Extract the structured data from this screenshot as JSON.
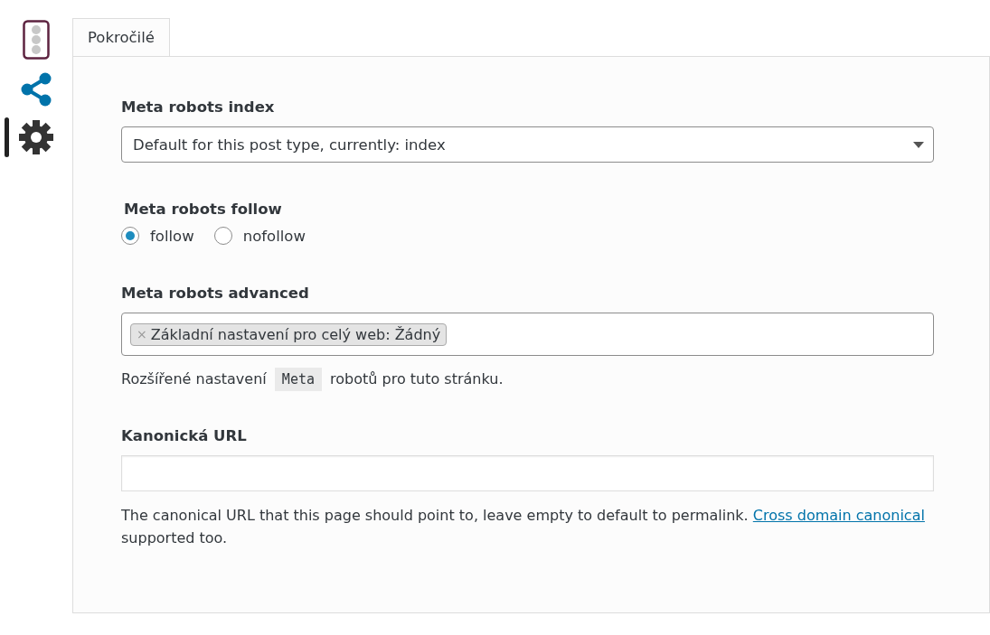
{
  "sidebar": {
    "items": [
      {
        "kind": "traffic-light",
        "selected": false
      },
      {
        "kind": "share",
        "selected": false
      },
      {
        "kind": "gear",
        "selected": true
      }
    ]
  },
  "tabs": [
    {
      "label": "Pokročilé",
      "selected": true
    }
  ],
  "robots_index": {
    "label": "Meta robots index",
    "value": "Default for this post type, currently: index"
  },
  "robots_follow": {
    "label": "Meta robots follow",
    "options": [
      {
        "label": "follow",
        "selected": true
      },
      {
        "label": "nofollow",
        "selected": false
      }
    ]
  },
  "robots_advanced": {
    "label": "Meta robots advanced",
    "tags": [
      {
        "remove": "×",
        "label": "Základní nastavení pro celý web: Žádný"
      }
    ],
    "help": {
      "before": "Rozšířené nastavení",
      "code": "Meta",
      "after": "robotů pro tuto stránku."
    }
  },
  "canonical": {
    "label": "Kanonická URL",
    "help": "The canonical URL that this page should point to, leave empty to default to permalink.",
    "link": "Cross domain canonical",
    "after": "supported too."
  }
}
